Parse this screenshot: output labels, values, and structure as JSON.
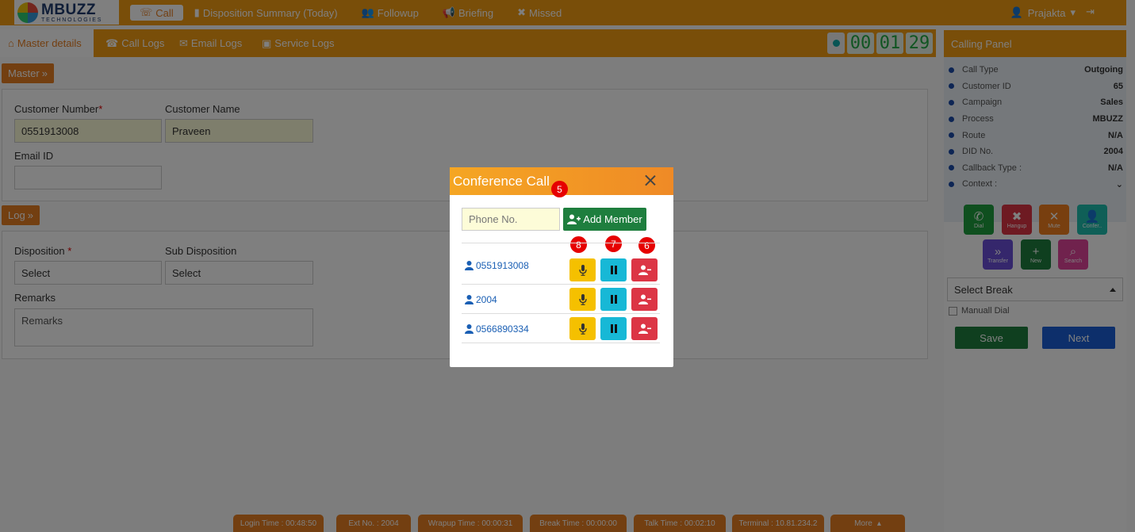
{
  "logo": {
    "brand": "MBUZZ",
    "sub": "TECHNOLOGIES"
  },
  "nav": {
    "call": "Call",
    "disposition": "Disposition Summary (Today)",
    "followup": "Followup",
    "briefing": "Briefing",
    "missed": "Missed"
  },
  "user": {
    "name": "Prajakta"
  },
  "tabs": {
    "master": "Master details",
    "call_logs": "Call Logs",
    "email_logs": "Email Logs",
    "service_logs": "Service Logs"
  },
  "timer": {
    "h": "00",
    "m": "01",
    "s": "29"
  },
  "master": {
    "button": "Master",
    "customer_number_label": "Customer Number",
    "customer_number": "0551913008",
    "customer_name_label": "Customer Name",
    "customer_name": "Praveen",
    "email_label": "Email ID",
    "email": ""
  },
  "log": {
    "button": "Log",
    "disposition_label": "Disposition",
    "disposition": "Select",
    "sub_disposition_label": "Sub Disposition",
    "sub_disposition": "Select",
    "remarks_label": "Remarks",
    "remarks_placeholder": "Remarks"
  },
  "calling_panel": {
    "title": "Calling Panel",
    "info": [
      {
        "k": "Call Type",
        "v": "Outgoing"
      },
      {
        "k": "Customer ID",
        "v": "65"
      },
      {
        "k": "Campaign",
        "v": "Sales"
      },
      {
        "k": "Process",
        "v": "MBUZZ"
      },
      {
        "k": "Route",
        "v": "N/A"
      },
      {
        "k": "DID No.",
        "v": "2004"
      },
      {
        "k": "Callback Type :",
        "v": "N/A"
      },
      {
        "k": "Context :",
        "v": ""
      }
    ],
    "buttons": {
      "dial": "Dial",
      "hangup": "Hangup",
      "mute": "Mute",
      "conference": "Confer..",
      "transfer": "Transfer",
      "new": "New",
      "search": "Search"
    },
    "select_break": "Select Break",
    "manual_dial": "Manuall Dial",
    "save": "Save",
    "next": "Next"
  },
  "status_bar": {
    "login": "Login Time : 00:48:50",
    "ext": "Ext No. : 2004",
    "wrapup": "Wrapup Time : 00:00:31",
    "break": "Break Time : 00:00:00",
    "talk": "Talk Time : 00:02:10",
    "terminal": "Terminal : 10.81.234.2",
    "more": "More"
  },
  "modal": {
    "title": "Conference Call",
    "phone_placeholder": "Phone No.",
    "add_member": "Add Member",
    "badges": {
      "title": "5",
      "mic": "8",
      "pause": "7",
      "remove": "6"
    },
    "members": [
      {
        "number": "0551913008"
      },
      {
        "number": "2004"
      },
      {
        "number": "0566890334"
      }
    ]
  },
  "colors": {
    "accent": "#f39c12",
    "save": "#1e7e3e",
    "next": "#1a5fd6"
  }
}
